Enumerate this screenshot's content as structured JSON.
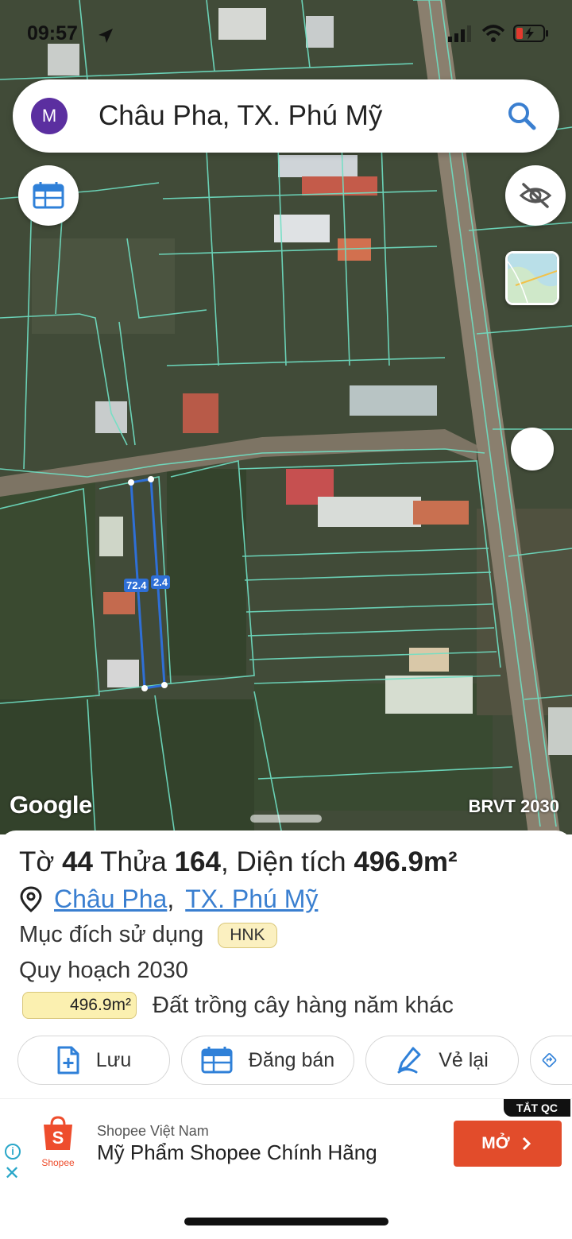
{
  "status_bar": {
    "time": "09:57"
  },
  "search": {
    "avatar_letter": "M",
    "query": "Châu Pha, TX. Phú Mỹ"
  },
  "map": {
    "attribution": "Google",
    "overlay_name": "BRVT 2030",
    "measure_left": "72.4",
    "measure_right": "2.4"
  },
  "parcel": {
    "title_prefix": "Tờ",
    "sheet_no": "44",
    "lot_label": "Thửa",
    "lot_no": "164",
    "area_label": "Diện tích",
    "area_value": "496.9m²",
    "location_commune": "Châu Pha",
    "location_town": "TX. Phú Mỹ",
    "purpose_label": "Mục đích sử dụng",
    "purpose_code": "HNK",
    "plan_label": "Quy hoạch 2030",
    "plan_area": "496.9m²",
    "plan_desc": "Đất trồng cây hàng năm khác"
  },
  "actions": {
    "save": "Lưu",
    "sell": "Đăng bán",
    "redraw": "Vẻ lại"
  },
  "ad": {
    "tag": "TẮT QC",
    "brand": "Shopee",
    "advertiser": "Shopee Việt Nam",
    "headline": "Mỹ Phẩm Shopee Chính Hãng",
    "cta": "MỞ"
  },
  "colors": {
    "parcel_line": "#6fe0c4",
    "highlight": "#2f6fd6",
    "link": "#3a7fd0",
    "cta": "#e24c2b",
    "tag_bg": "#fbf0b0"
  }
}
